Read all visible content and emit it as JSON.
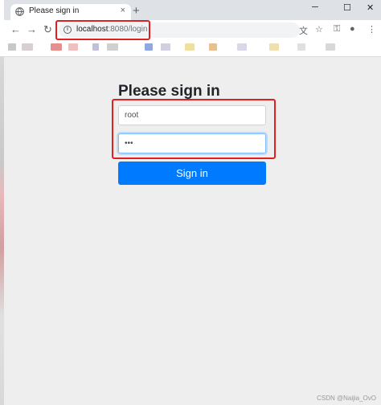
{
  "browser": {
    "tab": {
      "title": "Please sign in",
      "close": "×"
    },
    "new_tab": "+",
    "window": {
      "minimize": "─",
      "maximize": "☐",
      "close": "✕"
    },
    "nav": {
      "back": "←",
      "forward": "→",
      "reload": "↻"
    },
    "address": {
      "host": "localhost",
      "path": ":8080/login"
    },
    "icons": {
      "translate": "文",
      "bookmark": "☆",
      "key": "⚿",
      "account": "●",
      "menu": "⋮"
    }
  },
  "login": {
    "heading": "Please sign in",
    "username_value": "root",
    "password_value": "•••",
    "submit_label": "Sign in"
  },
  "watermark": "CSDN @Naijia_OvO",
  "colors": {
    "primary": "#007bff",
    "highlight": "#e02020",
    "page_bg": "#eeeeee"
  }
}
